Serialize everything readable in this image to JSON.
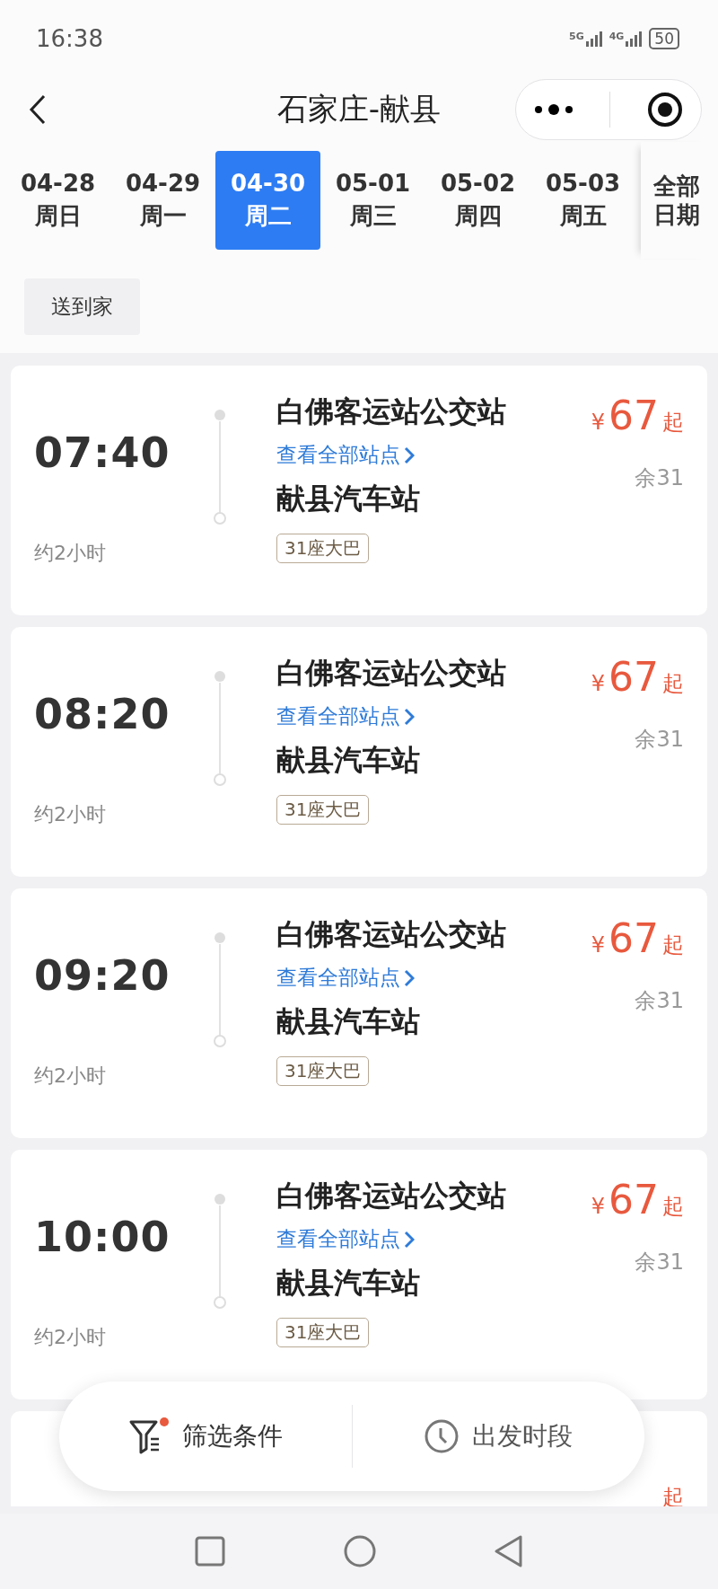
{
  "status_bar": {
    "time": "16:38",
    "networks": [
      "5G",
      "4G"
    ],
    "battery": "50"
  },
  "header": {
    "title": "石家庄-献县"
  },
  "date_tabs": [
    {
      "date": "04-28",
      "weekday": "周日",
      "selected": false
    },
    {
      "date": "04-29",
      "weekday": "周一",
      "selected": false
    },
    {
      "date": "04-30",
      "weekday": "周二",
      "selected": true
    },
    {
      "date": "05-01",
      "weekday": "周三",
      "selected": false
    },
    {
      "date": "05-02",
      "weekday": "周四",
      "selected": false
    },
    {
      "date": "05-03",
      "weekday": "周五",
      "selected": false
    }
  ],
  "all_dates": "全部日期",
  "filter_chips": [
    "送到家"
  ],
  "trips": [
    {
      "time": "07:40",
      "duration": "约2小时",
      "from": "白佛客运站公交站",
      "link": "查看全部站点",
      "to": "献县汽车站",
      "bus": "31座大巴",
      "currency": "¥",
      "price": "67",
      "price_suffix": "起",
      "seats": "余31"
    },
    {
      "time": "08:20",
      "duration": "约2小时",
      "from": "白佛客运站公交站",
      "link": "查看全部站点",
      "to": "献县汽车站",
      "bus": "31座大巴",
      "currency": "¥",
      "price": "67",
      "price_suffix": "起",
      "seats": "余31"
    },
    {
      "time": "09:20",
      "duration": "约2小时",
      "from": "白佛客运站公交站",
      "link": "查看全部站点",
      "to": "献县汽车站",
      "bus": "31座大巴",
      "currency": "¥",
      "price": "67",
      "price_suffix": "起",
      "seats": "余31"
    },
    {
      "time": "10:00",
      "duration": "约2小时",
      "from": "白佛客运站公交站",
      "link": "查看全部站点",
      "to": "献县汽车站",
      "bus": "31座大巴",
      "currency": "¥",
      "price": "67",
      "price_suffix": "起",
      "seats": "余31"
    },
    {
      "price_suffix": "起"
    }
  ],
  "bottom_bar": {
    "filter": {
      "label": "筛选条件",
      "badge": true
    },
    "departure": {
      "label": "出发时段"
    }
  }
}
